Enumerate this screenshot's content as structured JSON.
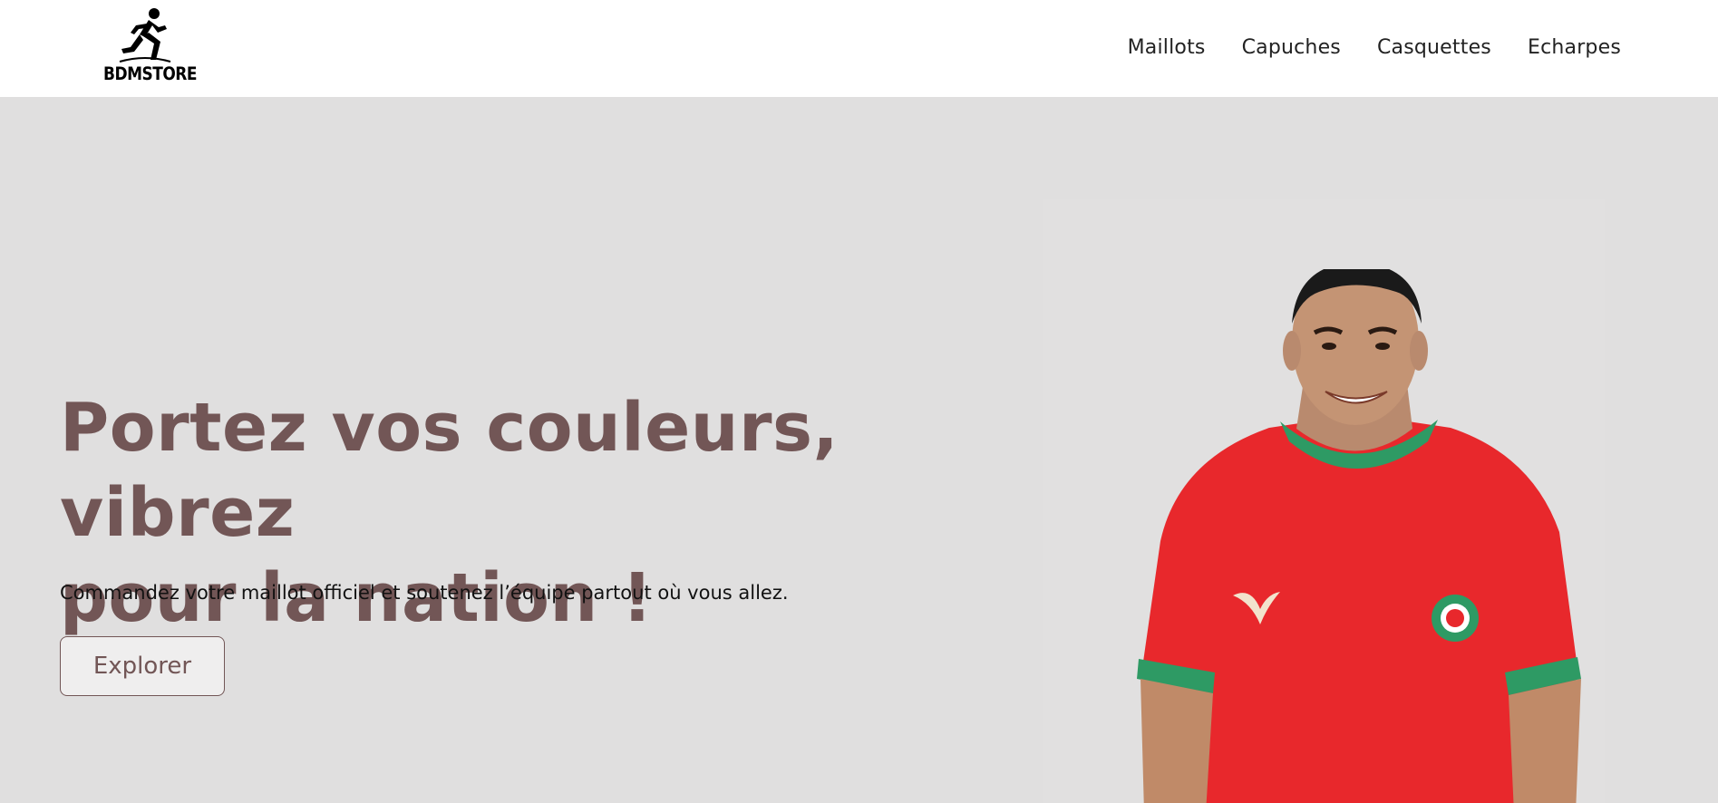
{
  "brand": {
    "name": "BDMSTORE",
    "logo_icon": "running-man-icon"
  },
  "nav": {
    "items": [
      {
        "label": "Maillots"
      },
      {
        "label": "Capuches"
      },
      {
        "label": "Casquettes"
      },
      {
        "label": "Echarpes"
      }
    ]
  },
  "hero": {
    "headline_line1": "Portez vos couleurs, vibrez",
    "headline_line2": "pour la nation !",
    "subtext": "Commandez votre maillot officiel et soutenez l’équipe partout où vous allez.",
    "cta_label": "Explorer",
    "image": "player-in-red-jersey"
  },
  "colors": {
    "accent": "#725656",
    "hero_background": "#e0dfdf",
    "jersey_red": "#e8282c",
    "jersey_green": "#2e9a64"
  }
}
